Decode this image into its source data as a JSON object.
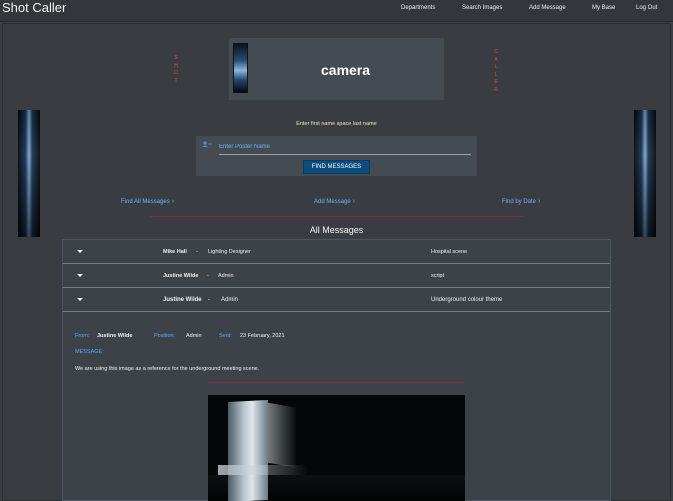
{
  "nav": {
    "brand": "Shot Caller",
    "links": [
      "Departments",
      "Search Images",
      "Add Message",
      "My Base",
      "Log Out"
    ]
  },
  "header": {
    "word": "camera",
    "left_vertical": [
      "S",
      "H",
      "O",
      "T"
    ],
    "right_vertical": [
      "C",
      "A",
      "L",
      "L",
      "E",
      "R"
    ]
  },
  "search": {
    "instruction": "Enter first name space last name",
    "placeholder": "Enter Poster Name",
    "button": "FIND MESSAGES"
  },
  "links": {
    "find_all": "Find All Messages",
    "add_message": "Add Message",
    "find_by_date": "Find by Date"
  },
  "messages": {
    "title": "All Messages",
    "separator": "-",
    "rows": [
      {
        "name": "Mike Hall",
        "position": "Lighting Designer",
        "subject": "Hospital scene"
      },
      {
        "name": "Justine Wilde",
        "position": "Admin",
        "subject": "script"
      },
      {
        "name": "Justine Wilde",
        "position": "Admin",
        "subject": "Underground colour theme"
      }
    ],
    "detail": {
      "from_label": "From:",
      "from_value": "Justine Wilde",
      "position_label": "Position:",
      "position_value": "Admin",
      "sent_label": "Sent:",
      "sent_value": "23 February, 2021",
      "message_label": "MESSAGE:",
      "message_body": "We are using this image as a reference for the underground meeting scene."
    }
  },
  "colors": {
    "accent_blue": "#6cb4ff",
    "button_blue": "#0d4c7e",
    "vertical_red": "#e24848",
    "divider_red": "#7c2c3a"
  },
  "icons": [
    "person-icon",
    "chevron-right-icon",
    "caret-down-icon"
  ]
}
